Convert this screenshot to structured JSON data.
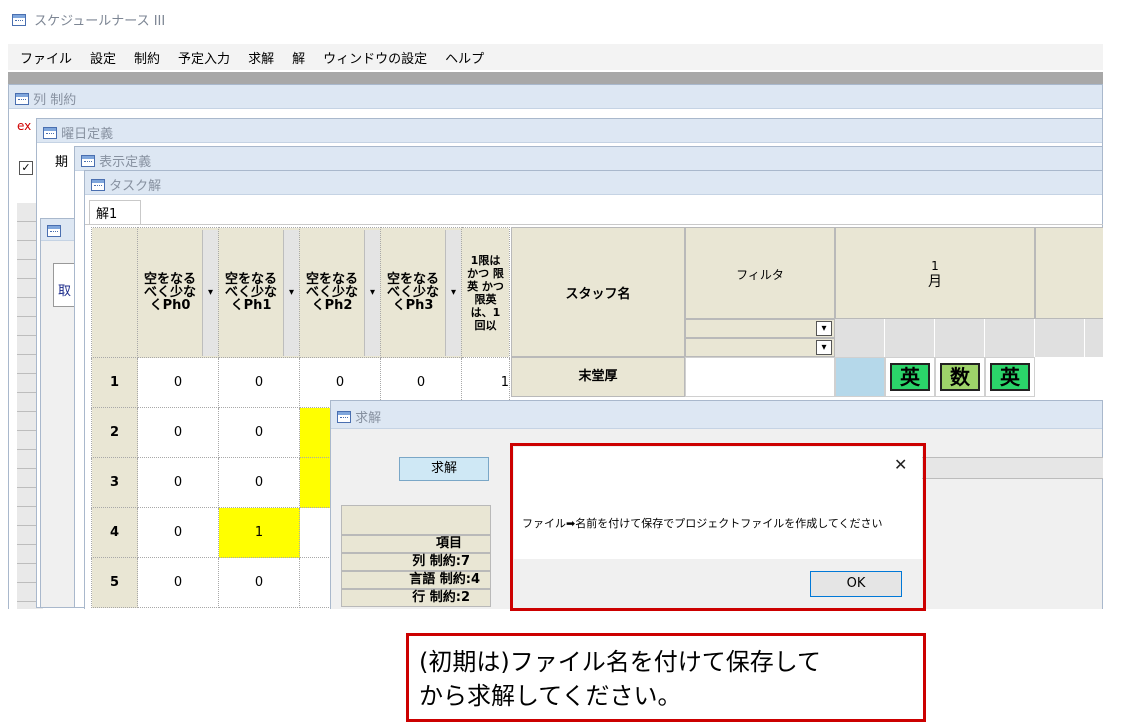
{
  "app": {
    "title": "スケジュールナース III"
  },
  "menu": [
    "ファイル",
    "設定",
    "制約",
    "予定入力",
    "求解",
    "解",
    "ウィンドウの設定",
    "ヘルプ"
  ],
  "windows": {
    "w1": {
      "title": "列 制約",
      "frag_red": "ex"
    },
    "w2": {
      "title": "曜日定義",
      "frag": "期"
    },
    "w3": {
      "title": "表示定義"
    },
    "w4": {
      "frag": "取"
    },
    "task": {
      "title": "タスク解",
      "tab": "解1",
      "columns": [
        {
          "label": "空をなるべく少なくPh0"
        },
        {
          "label": "空をなるべく少なくPh1"
        },
        {
          "label": "空をなるべく少なくPh2"
        },
        {
          "label": "空をなるべく少なくPh3"
        },
        {
          "label": "1限は かつ 限英 かつ 限英 は、1 回以"
        }
      ],
      "rows": [
        {
          "num": "1",
          "vals": [
            "0",
            "0",
            "0",
            "0",
            "1"
          ]
        },
        {
          "num": "2",
          "vals": [
            "0",
            "0",
            "",
            "",
            ""
          ]
        },
        {
          "num": "3",
          "vals": [
            "0",
            "0",
            "",
            "",
            ""
          ]
        },
        {
          "num": "4",
          "vals": [
            "0",
            "1",
            "",
            "",
            ""
          ]
        },
        {
          "num": "5",
          "vals": [
            "0",
            "0",
            "",
            "",
            ""
          ]
        }
      ],
      "highlight_color": "#ffff00",
      "staff_header": "スタッフ名",
      "filter_header": "フィルタ",
      "day_num": "1",
      "day_wd": "月",
      "dropdown_glyph": "▾",
      "staff_row": {
        "name": "末堂厚",
        "badges": [
          {
            "text": "英",
            "color": "#2bd46a"
          },
          {
            "text": "数",
            "color": "#9ed36a"
          },
          {
            "text": "英",
            "color": "#2bd46a"
          }
        ]
      }
    },
    "solve": {
      "title": "求解",
      "button": "求解",
      "table_header": "項目",
      "items": [
        "列 制約:7",
        "言語 制約:4",
        "行 制約:2"
      ]
    }
  },
  "dialog": {
    "close_glyph": "✕",
    "message": "ファイル➡名前を付けて保存でプロジェクトファイルを作成してください",
    "ok": "OK",
    "highlight_color": "#cc0000"
  },
  "callout": {
    "line1": "(初期は)ファイル名を付けて保存して",
    "line2": "から求解してください。",
    "border_color": "#cc0000"
  }
}
